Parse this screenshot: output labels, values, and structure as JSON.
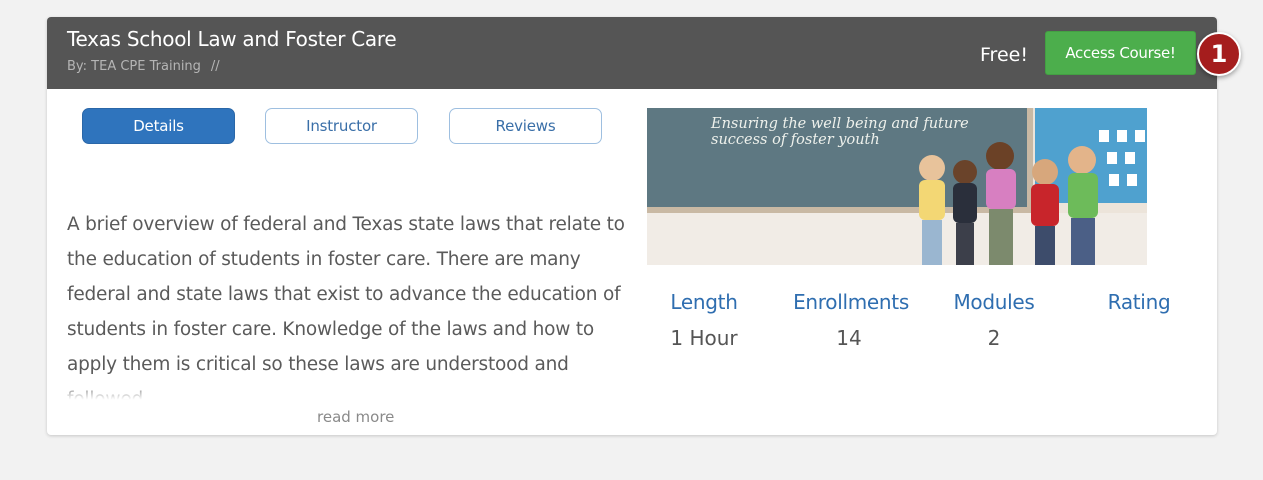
{
  "course": {
    "title": "Texas School Law and Foster Care",
    "byline": "By: TEA CPE Training",
    "byline_separator": "//",
    "price": "Free!",
    "access_button": "Access Course!"
  },
  "tabs": [
    {
      "label": "Details",
      "active": true
    },
    {
      "label": "Instructor",
      "active": false
    },
    {
      "label": "Reviews",
      "active": false
    }
  ],
  "description": "A brief overview of federal and Texas state laws that relate to the education of students in foster care.  There are many federal and state laws that exist to advance the education of students in foster care. Knowledge of the laws and how to apply them is critical so these laws are understood and followed.",
  "read_more": "read more",
  "banner": {
    "text": "Ensuring the well being and future success of foster youth"
  },
  "stats": [
    {
      "label": "Length",
      "value": "1 Hour"
    },
    {
      "label": "Enrollments",
      "value": "14"
    },
    {
      "label": "Modules",
      "value": "2"
    },
    {
      "label": "Rating",
      "value": ""
    }
  ],
  "annotation": {
    "step": "1"
  },
  "colors": {
    "header_bg": "#555555",
    "accent_blue": "#2f74bd",
    "button_green": "#4cae4c",
    "badge_red": "#a51d1d"
  }
}
